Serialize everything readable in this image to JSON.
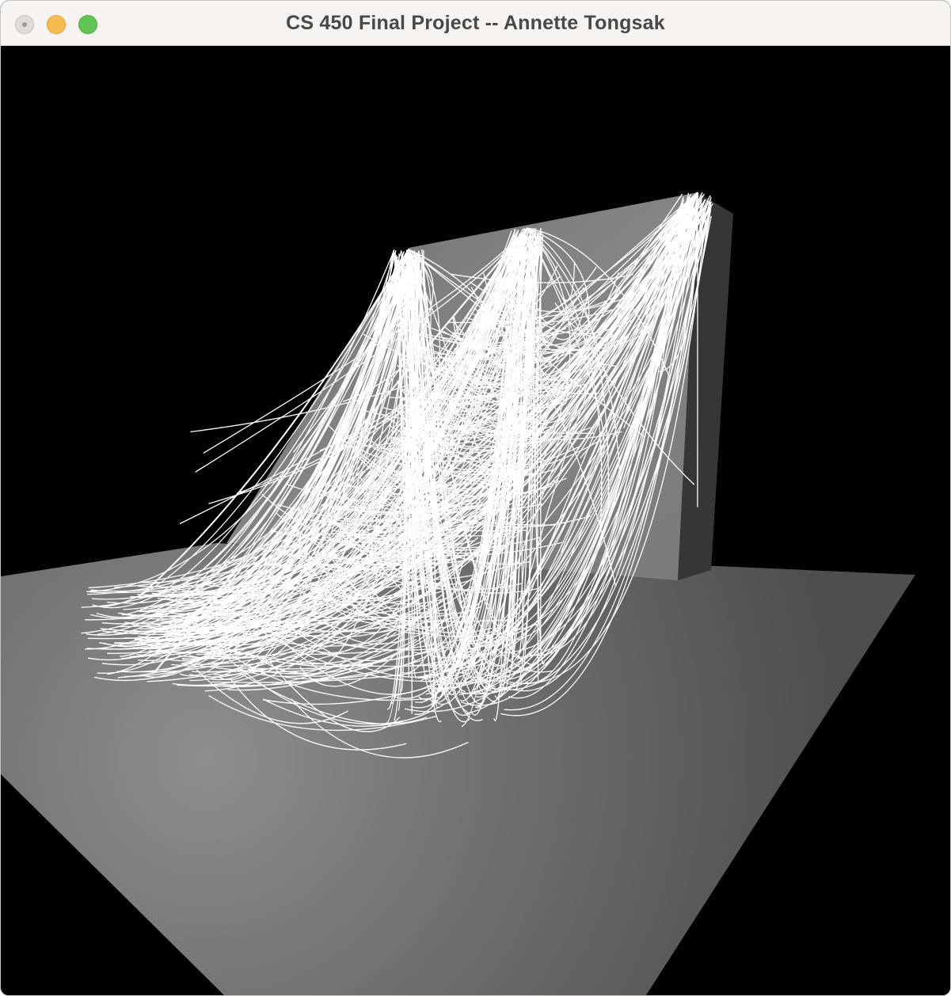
{
  "window": {
    "title": "CS 450 Final Project -- Annette Tongsak"
  },
  "scene": {
    "background_color": "#000000",
    "floor_color": "#6e6e6e",
    "wall_color": "#7a7a7a",
    "web_color": "#ffffff"
  }
}
